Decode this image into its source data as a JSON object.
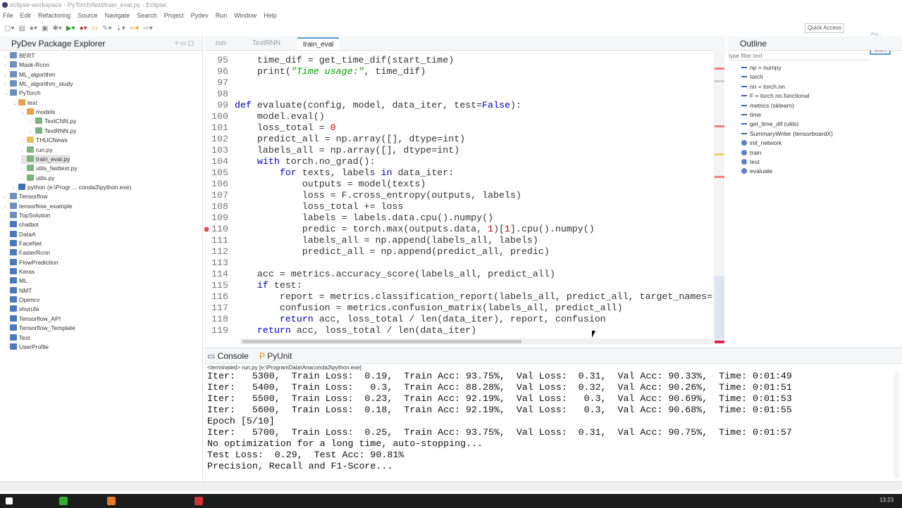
{
  "window": {
    "title": "eclipse-workspace - PyTorch/text/train_eval.py - Eclipse"
  },
  "menu": [
    "File",
    "Edit",
    "Refactoring",
    "Source",
    "Navigate",
    "Search",
    "Project",
    "Pydev",
    "Run",
    "Window",
    "Help"
  ],
  "toolbar": {
    "quick_access": "Quick Access",
    "start_button": "Start",
    "popup_text": "Poi..."
  },
  "explorer": {
    "title": "PyDev Package Explorer",
    "items": [
      {
        "label": "BERT",
        "depth": 0,
        "kind": "project",
        "expanded": false
      },
      {
        "label": "Mask-Rcnn",
        "depth": 0,
        "kind": "project",
        "expanded": false
      },
      {
        "label": "ML_algorithm",
        "depth": 0,
        "kind": "project",
        "expanded": false
      },
      {
        "label": "ML_algorithm_study",
        "depth": 0,
        "kind": "project",
        "expanded": false
      },
      {
        "label": "PyTorch",
        "depth": 0,
        "kind": "project",
        "expanded": true
      },
      {
        "label": "text",
        "depth": 1,
        "kind": "package",
        "expanded": true
      },
      {
        "label": "models",
        "depth": 2,
        "kind": "package",
        "expanded": true
      },
      {
        "label": "TextCNN.py",
        "depth": 3,
        "kind": "file",
        "expanded": false
      },
      {
        "label": "TextRNN.py",
        "depth": 3,
        "kind": "file",
        "expanded": false
      },
      {
        "label": "THUCNews",
        "depth": 2,
        "kind": "folder",
        "expanded": false
      },
      {
        "label": "run.py",
        "depth": 2,
        "kind": "file",
        "expanded": false
      },
      {
        "label": "train_eval.py",
        "depth": 2,
        "kind": "file",
        "expanded": false,
        "selected": true
      },
      {
        "label": "utils_fasttext.py",
        "depth": 2,
        "kind": "file",
        "expanded": false
      },
      {
        "label": "utils.py",
        "depth": 2,
        "kind": "file",
        "expanded": false
      },
      {
        "label": "python  (e:\\Progr ... conda3\\python.exe)",
        "depth": 1,
        "kind": "python",
        "expanded": false
      },
      {
        "label": "Tensorflow",
        "depth": 0,
        "kind": "project",
        "expanded": false
      },
      {
        "label": "tensorflow_example",
        "depth": 0,
        "kind": "project",
        "expanded": false
      },
      {
        "label": "TopSolution",
        "depth": 0,
        "kind": "project",
        "expanded": false
      },
      {
        "label": "chatbot",
        "depth": 0,
        "kind": "closed"
      },
      {
        "label": "DataA",
        "depth": 0,
        "kind": "closed"
      },
      {
        "label": "FaceNet",
        "depth": 0,
        "kind": "closed"
      },
      {
        "label": "FasterRcnn",
        "depth": 0,
        "kind": "closed"
      },
      {
        "label": "FlowPrediction",
        "depth": 0,
        "kind": "closed"
      },
      {
        "label": "Keras",
        "depth": 0,
        "kind": "closed"
      },
      {
        "label": "ML",
        "depth": 0,
        "kind": "closed"
      },
      {
        "label": "NMT",
        "depth": 0,
        "kind": "closed"
      },
      {
        "label": "Opencv",
        "depth": 0,
        "kind": "closed"
      },
      {
        "label": "shurufa",
        "depth": 0,
        "kind": "closed"
      },
      {
        "label": "Tensorflow_API",
        "depth": 0,
        "kind": "closed"
      },
      {
        "label": "Tensorflow_Template",
        "depth": 0,
        "kind": "closed"
      },
      {
        "label": "Test",
        "depth": 0,
        "kind": "closed"
      },
      {
        "label": "UserProfile",
        "depth": 0,
        "kind": "closed"
      }
    ]
  },
  "editor": {
    "tabs": [
      {
        "label": "run"
      },
      {
        "label": "TextRNN"
      },
      {
        "label": "train_eval",
        "active": true
      }
    ],
    "lines": [
      {
        "n": "95",
        "t": [
          [
            "    time_dif = get_time_dif(start_time)",
            ""
          ]
        ]
      },
      {
        "n": "96",
        "t": [
          [
            "    print(",
            ""
          ],
          [
            "\"Time usage:\"",
            "str"
          ],
          [
            ", time_dif)",
            ""
          ]
        ]
      },
      {
        "n": "97",
        "t": []
      },
      {
        "n": "98",
        "t": []
      },
      {
        "n": "99",
        "t": [
          [
            "def",
            "kw"
          ],
          [
            " evaluate(config, model, data_iter, test=",
            ""
          ],
          [
            "False",
            "kw"
          ],
          [
            "):",
            ""
          ]
        ]
      },
      {
        "n": "100",
        "t": [
          [
            "    model.eval()",
            ""
          ]
        ]
      },
      {
        "n": "101",
        "t": [
          [
            "    loss_total = ",
            ""
          ],
          [
            "0",
            "num"
          ]
        ]
      },
      {
        "n": "102",
        "t": [
          [
            "    predict_all = np.array([], dtype=int)",
            ""
          ]
        ]
      },
      {
        "n": "103",
        "t": [
          [
            "    labels_all = np.array([], dtype=int)",
            ""
          ]
        ]
      },
      {
        "n": "104",
        "t": [
          [
            "    ",
            ""
          ],
          [
            "with",
            "kw"
          ],
          [
            " torch.no_grad():",
            ""
          ]
        ]
      },
      {
        "n": "105",
        "t": [
          [
            "        ",
            ""
          ],
          [
            "for",
            "kw"
          ],
          [
            " texts, labels ",
            ""
          ],
          [
            "in",
            "kw"
          ],
          [
            " data_iter:",
            ""
          ]
        ]
      },
      {
        "n": "106",
        "t": [
          [
            "            outputs = model(texts)",
            ""
          ]
        ]
      },
      {
        "n": "107",
        "t": [
          [
            "            loss = F.cross_entropy(outputs, labels)",
            ""
          ]
        ]
      },
      {
        "n": "108",
        "t": [
          [
            "            loss_total += loss",
            ""
          ]
        ]
      },
      {
        "n": "109",
        "t": [
          [
            "            labels = labels.data.cpu().numpy()",
            ""
          ]
        ]
      },
      {
        "n": "110",
        "t": [
          [
            "            predic = torch.max(outputs.data, ",
            ""
          ],
          [
            "1",
            "num"
          ],
          [
            ")[",
            ""
          ],
          [
            "1",
            "num"
          ],
          [
            "].cpu().numpy()",
            ""
          ]
        ],
        "error": true
      },
      {
        "n": "111",
        "t": [
          [
            "            labels_all = np.append(labels_all, labels)",
            ""
          ]
        ]
      },
      {
        "n": "112",
        "t": [
          [
            "            predict_all = np.append(predict_all, predic)",
            ""
          ]
        ]
      },
      {
        "n": "113",
        "t": []
      },
      {
        "n": "114",
        "t": [
          [
            "    acc = metrics.accuracy_score(labels_all, predict_all)",
            ""
          ]
        ]
      },
      {
        "n": "115",
        "t": [
          [
            "    ",
            ""
          ],
          [
            "if",
            "kw"
          ],
          [
            " test:",
            ""
          ]
        ]
      },
      {
        "n": "116",
        "t": [
          [
            "        report = metrics.classification_report(labels_all, predict_all, target_names=",
            ""
          ]
        ]
      },
      {
        "n": "117",
        "t": [
          [
            "        confusion = metrics.confusion_matrix(labels_all, predict_all)",
            ""
          ]
        ]
      },
      {
        "n": "118",
        "t": [
          [
            "        ",
            ""
          ],
          [
            "return",
            "kw"
          ],
          [
            " acc, loss_total / len(data_iter), report, confusion",
            ""
          ]
        ]
      },
      {
        "n": "119",
        "t": [
          [
            "    ",
            ""
          ],
          [
            "return",
            "kw"
          ],
          [
            " acc, loss_total / len(data_iter)",
            ""
          ]
        ]
      }
    ]
  },
  "outline": {
    "title": "Outline",
    "filter_placeholder": "type filter text",
    "items": [
      {
        "label": "np = numpy",
        "kind": "import"
      },
      {
        "label": "torch",
        "kind": "import"
      },
      {
        "label": "nn = torch.nn",
        "kind": "import"
      },
      {
        "label": "F = torch.nn.functional",
        "kind": "import"
      },
      {
        "label": "metrics (sklearn)",
        "kind": "import"
      },
      {
        "label": "time",
        "kind": "import"
      },
      {
        "label": "get_time_dif (utils)",
        "kind": "import"
      },
      {
        "label": "SummaryWriter (tensorboardX)",
        "kind": "import"
      },
      {
        "label": "init_network",
        "kind": "function"
      },
      {
        "label": "train",
        "kind": "function"
      },
      {
        "label": "test",
        "kind": "function"
      },
      {
        "label": "evaluate",
        "kind": "function"
      }
    ]
  },
  "console": {
    "tabs": [
      {
        "label": "Console"
      },
      {
        "label": "PyUnit"
      }
    ],
    "status": "<terminated> run.py [e:\\ProgramData\\Anaconda3\\python.exe]",
    "lines": [
      "Iter:   5300,  Train Loss:  0.19,  Train Acc: 93.75%,  Val Loss:  0.31,  Val Acc: 90.33%,  Time: 0:01:49",
      "Iter:   5400,  Train Loss:   0.3,  Train Acc: 88.28%,  Val Loss:  0.32,  Val Acc: 90.26%,  Time: 0:01:51",
      "Iter:   5500,  Train Loss:  0.23,  Train Acc: 92.19%,  Val Loss:   0.3,  Val Acc: 90.69%,  Time: 0:01:53",
      "Iter:   5600,  Train Loss:  0.18,  Train Acc: 92.19%,  Val Loss:   0.3,  Val Acc: 90.68%,  Time: 0:01:55",
      "Epoch [5/10]",
      "Iter:   5700,  Train Loss:  0.25,  Train Acc: 93.75%,  Val Loss:  0.31,  Val Acc: 90.75%,  Time: 0:01:57",
      "No optimization for a long time, auto-stopping...",
      "Test Loss:  0.29,  Test Acc: 90.81%",
      "Precision, Recall and F1-Score..."
    ]
  },
  "taskbar": {
    "clock": "13:23"
  }
}
